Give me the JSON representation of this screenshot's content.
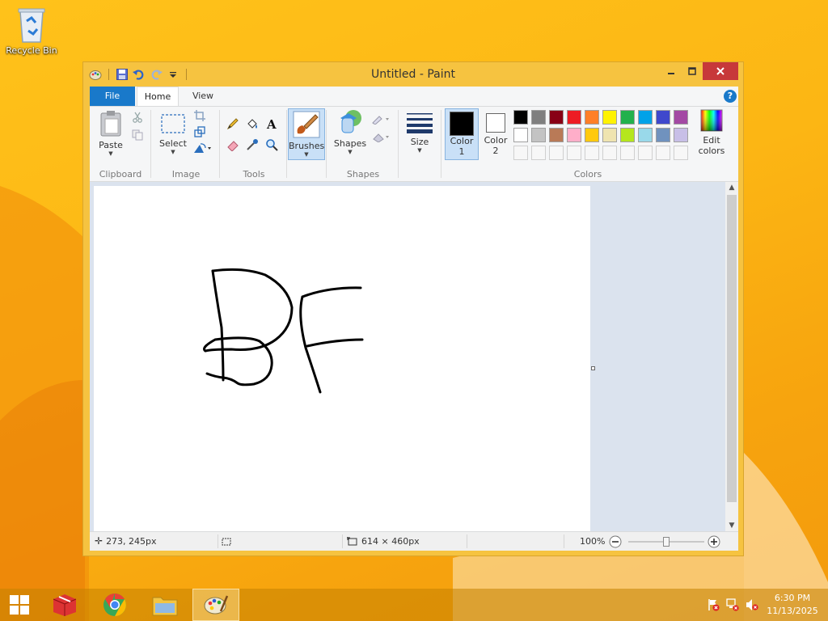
{
  "desktop": {
    "recycle_bin_label": "Recycle Bin"
  },
  "window": {
    "title": "Untitled - Paint",
    "controls": {
      "minimize": "–",
      "maximize": "□",
      "close": "✕"
    }
  },
  "ribbon_tabs": {
    "file": "File",
    "home": "Home",
    "view": "View",
    "help": "?"
  },
  "ribbon": {
    "clipboard": {
      "label": "Clipboard",
      "paste": "Paste"
    },
    "image": {
      "label": "Image",
      "select": "Select"
    },
    "tools": {
      "label": "Tools"
    },
    "brushes": {
      "label": "Brushes"
    },
    "shapes": {
      "label": "Shapes",
      "shapes_button": "Shapes"
    },
    "size": {
      "label": "Size"
    },
    "colors": {
      "label": "Colors",
      "color1_line1": "Color",
      "color1_line2": "1",
      "color2_line1": "Color",
      "color2_line2": "2",
      "edit_line1": "Edit",
      "edit_line2": "colors",
      "color1_value": "#000000",
      "color2_value": "#ffffff",
      "palette_row1": [
        "#000000",
        "#7f7f7f",
        "#880015",
        "#ed1c24",
        "#ff7f27",
        "#fff200",
        "#22b14c",
        "#00a2e8",
        "#3f48cc",
        "#a349a4"
      ],
      "palette_row2": [
        "#ffffff",
        "#c3c3c3",
        "#b97a57",
        "#ffaec9",
        "#ffc90e",
        "#efe4b0",
        "#b5e61d",
        "#99d9ea",
        "#7092be",
        "#c8bfe7"
      ]
    }
  },
  "statusbar": {
    "cursor_position": "273, 245px",
    "canvas_size": "614 × 460px",
    "zoom": "100%",
    "zoom_level": 1.0
  },
  "taskbar": {
    "time": "6:30 PM",
    "date": "11/13/2025"
  }
}
